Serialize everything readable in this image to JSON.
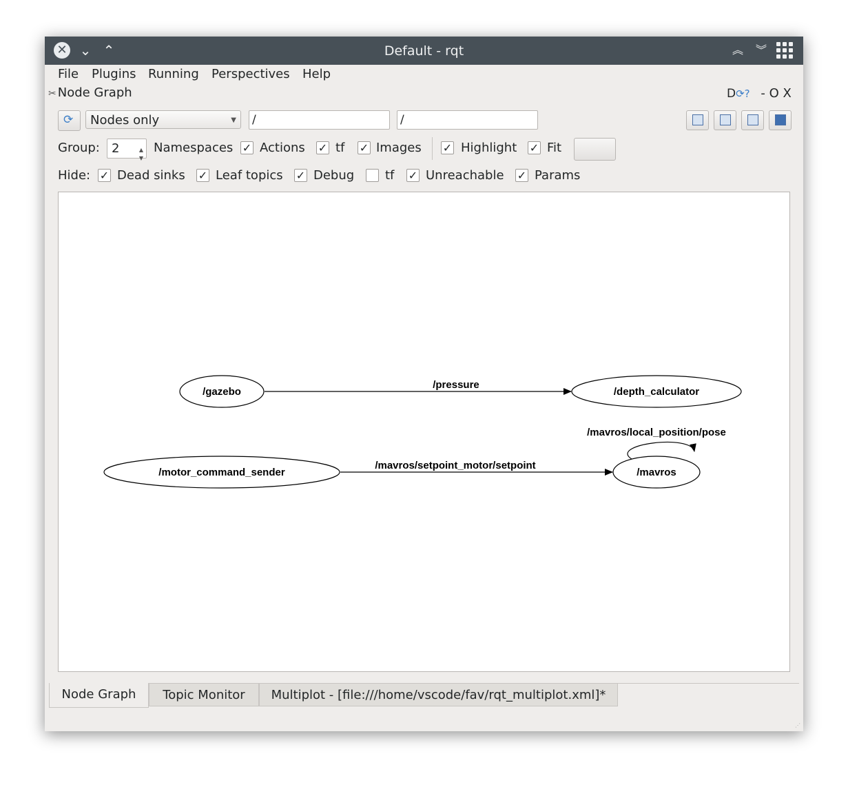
{
  "window": {
    "title": "Default - rqt"
  },
  "menu": [
    {
      "label": "File"
    },
    {
      "label": "Plugins"
    },
    {
      "label": "Running"
    },
    {
      "label": "Perspectives"
    },
    {
      "label": "Help"
    }
  ],
  "plugin": {
    "title": "Node Graph",
    "controls": "D",
    "window_controls": "- O X"
  },
  "toolbar": {
    "mode_selected": "Nodes only",
    "node_filter": "/",
    "topic_filter": "/"
  },
  "options": {
    "group_label": "Group:",
    "group_value": "2",
    "namespaces": "Namespaces",
    "actions": "Actions",
    "tf": "tf",
    "images": "Images",
    "highlight": "Highlight",
    "fit": "Fit"
  },
  "hide": {
    "label": "Hide:",
    "dead_sinks": "Dead sinks",
    "leaf_topics": "Leaf topics",
    "debug": "Debug",
    "tf": "tf",
    "unreachable": "Unreachable",
    "params": "Params"
  },
  "checks": {
    "actions": true,
    "tf": true,
    "images": true,
    "highlight": true,
    "fit": true,
    "dead_sinks": true,
    "leaf_topics": true,
    "debug": true,
    "hide_tf": false,
    "unreachable": true,
    "params": true
  },
  "graph": {
    "nodes": {
      "gazebo": "/gazebo",
      "depth_calculator": "/depth_calculator",
      "motor_command_sender": "/motor_command_sender",
      "mavros": "/mavros"
    },
    "edges": {
      "pressure": "/pressure",
      "setpoint": "/mavros/setpoint_motor/setpoint",
      "local_pose": "/mavros/local_position/pose"
    }
  },
  "tabs": [
    {
      "label": "Node Graph"
    },
    {
      "label": "Topic Monitor"
    },
    {
      "label": "Multiplot - [file:///home/vscode/fav/rqt_multiplot.xml]*"
    }
  ]
}
